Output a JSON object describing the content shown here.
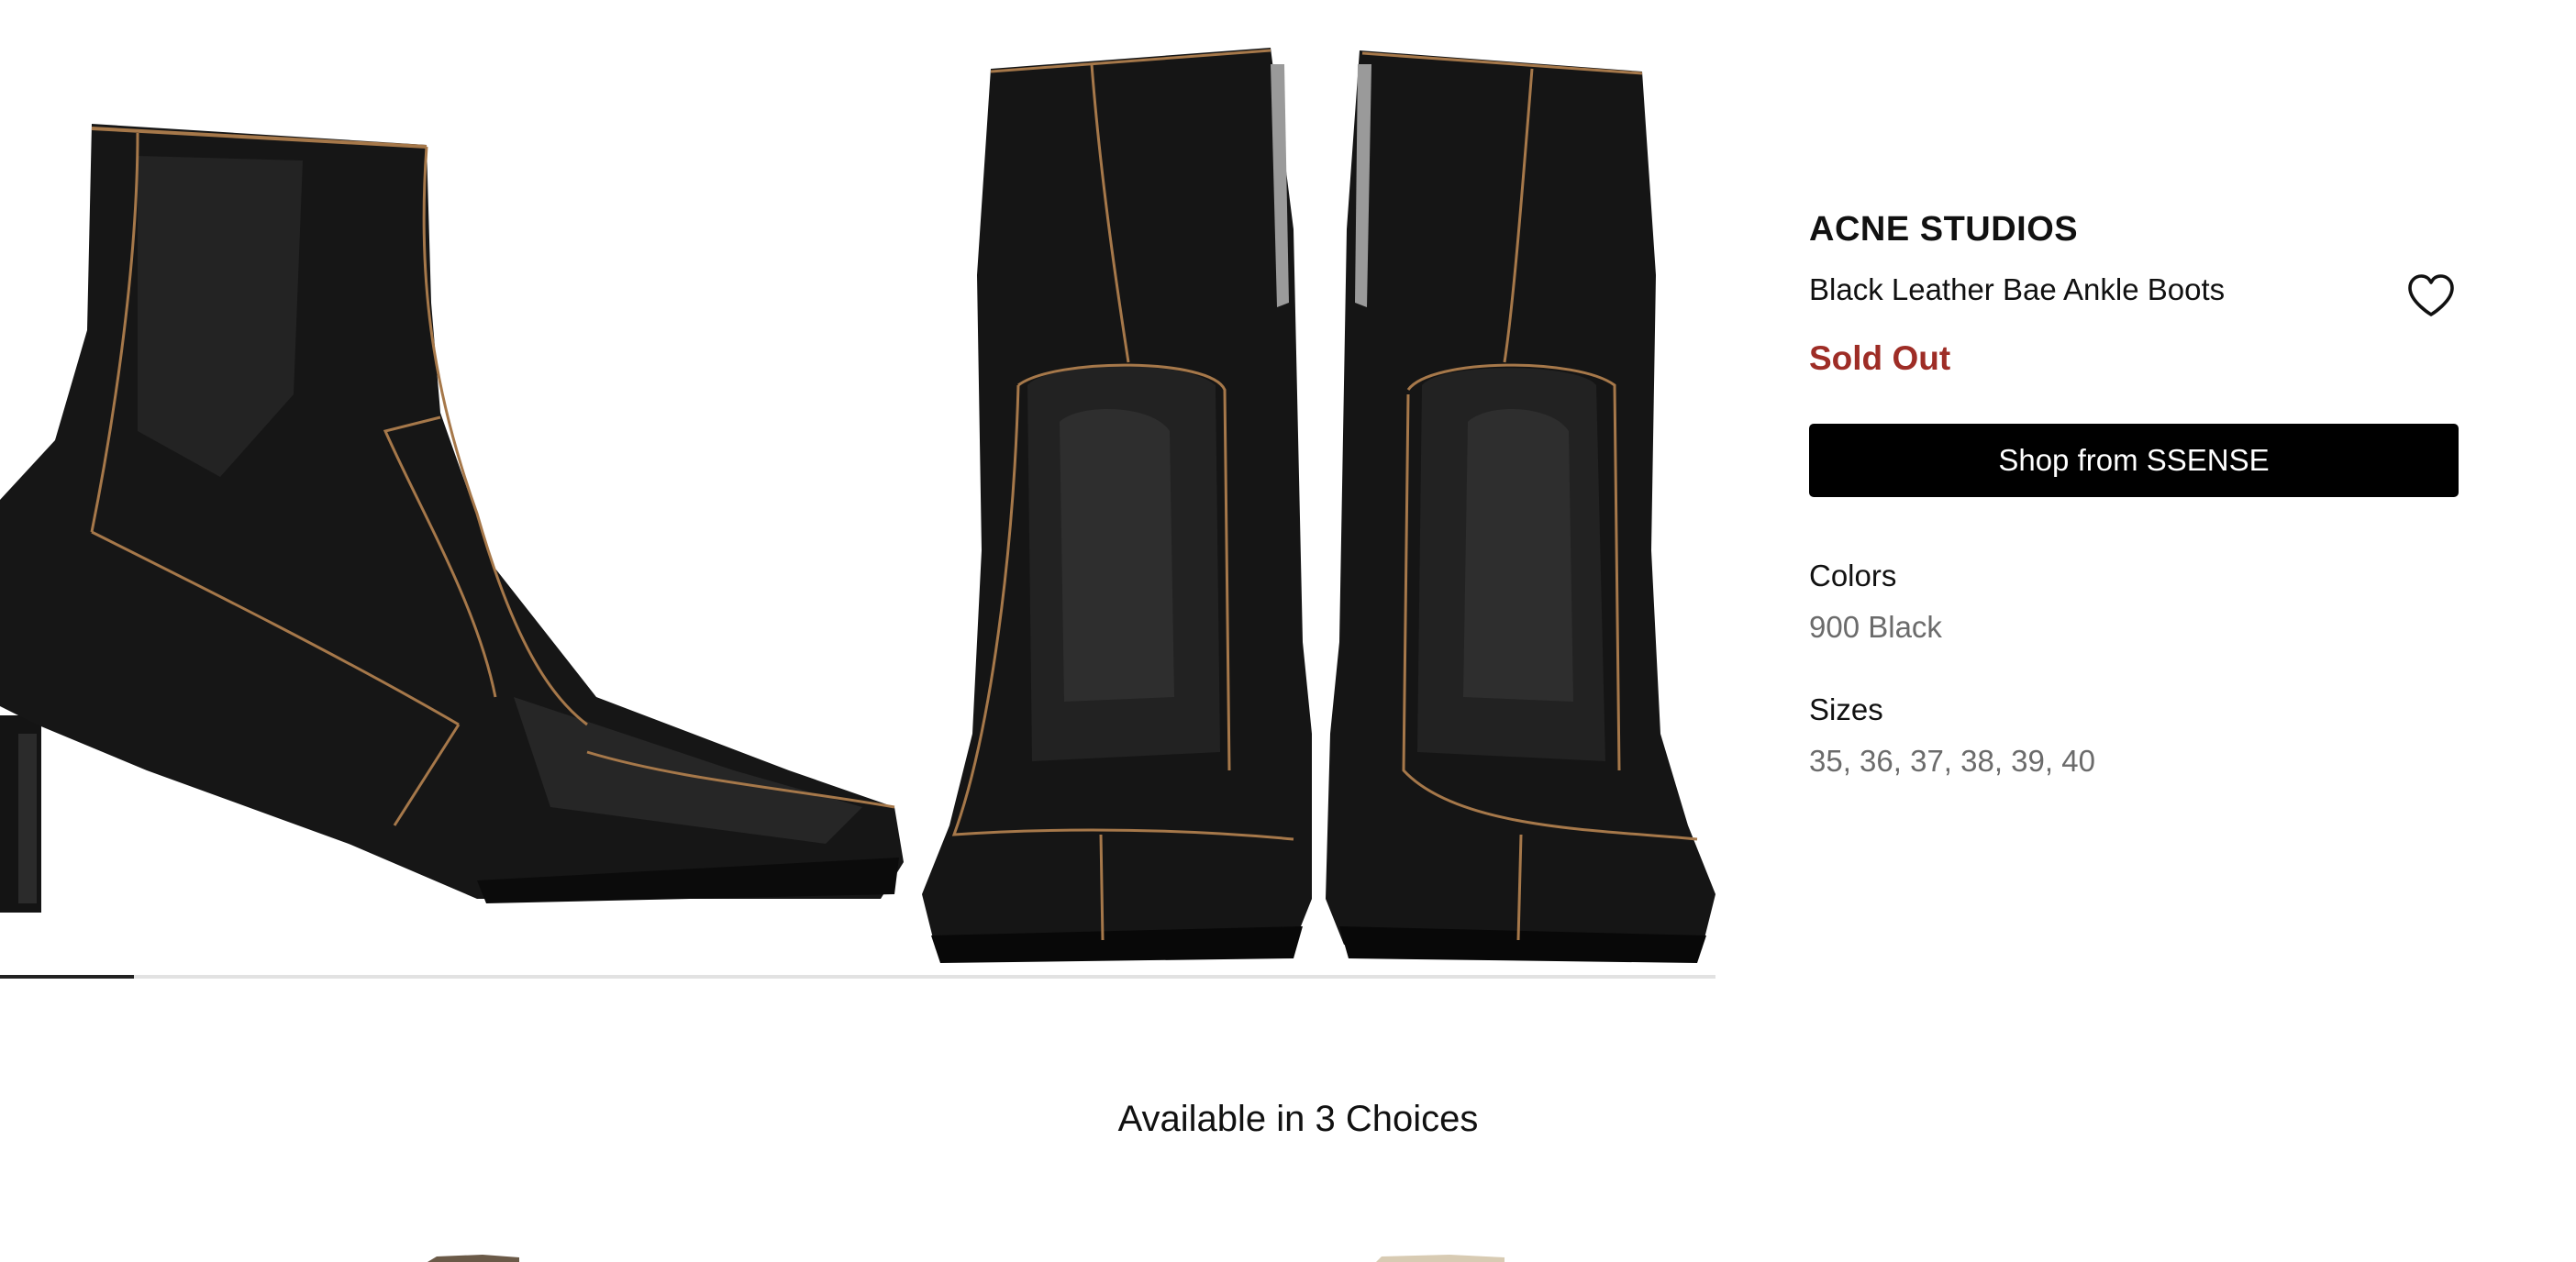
{
  "product": {
    "brand": "ACNE STUDIOS",
    "name": "Black Leather Bae Ankle Boots",
    "status": "Sold Out",
    "shop_button_label": "Shop from SSENSE",
    "colors_label": "Colors",
    "colors_value": "900 Black",
    "sizes_label": "Sizes",
    "sizes_value": "35, 36, 37, 38, 39, 40"
  },
  "gallery": {
    "progress_fraction": 0.078
  },
  "choices": {
    "title": "Available in 3 Choices"
  },
  "colors": {
    "status": "#9e2d26",
    "button_bg": "#000000",
    "muted_text": "#6b6b6b"
  },
  "icons": {
    "wishlist": "heart-outline-icon"
  }
}
